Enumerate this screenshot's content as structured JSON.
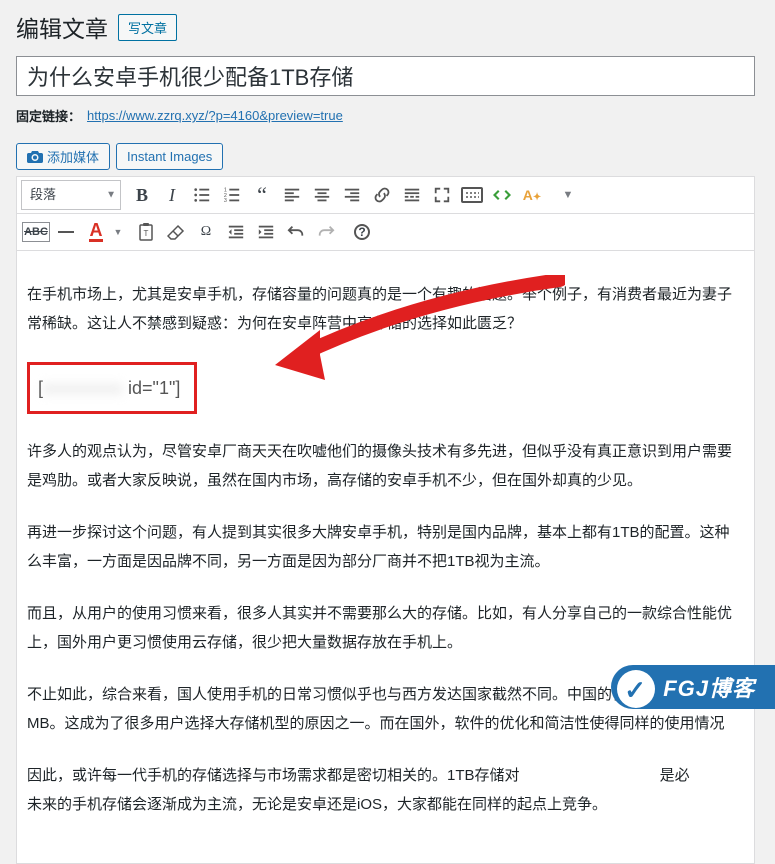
{
  "heading": {
    "title": "编辑文章",
    "new_post": "写文章"
  },
  "title_input": {
    "value": "为什么安卓手机很少配备1TB存储"
  },
  "permalink": {
    "label": "固定链接：",
    "url": "https://www.zzrq.xyz/?p=4160&preview=true"
  },
  "media": {
    "add_media": "添加媒体",
    "instant_images": "Instant Images"
  },
  "toolbar": {
    "format": "段落",
    "abc_strike": "ABC"
  },
  "shortcode": {
    "open": "[",
    "hidden": "xxxxxxxx",
    "suffix": "id=\"1\"]"
  },
  "content": {
    "p1": "在手机市场上，尤其是安卓手机，存储容量的问题真的是一个有趣的话题。举个例子，有消费者最近为妻子",
    "p2": "常稀缺。这让人不禁感到疑惑：为何在安卓阵营中高存储的选择如此匮乏？",
    "p3": "许多人的观点认为，尽管安卓厂商天天在吹嘘他们的摄像头技术有多先进，但似乎没有真正意识到用户需要",
    "p4": "是鸡肋。或者大家反映说，虽然在国内市场，高存储的安卓手机不少，但在国外却真的少见。",
    "p5": "再进一步探讨这个问题，有人提到其实很多大牌安卓手机，特别是国内品牌，基本上都有1TB的配置。这种",
    "p6": "么丰富，一方面是因品牌不同，另一方面是因为部分厂商并不把1TB视为主流。",
    "p7": "而且，从用户的使用习惯来看，很多人其实并不需要那么大的存储。比如，有人分享自己的一款综合性能优",
    "p8": "上，国外用户更习惯使用云存储，很少把大量数据存放在手机上。",
    "p9": "不止如此，综合来看，国人使用手机的日常习惯似乎也与西方发达国家截然不同。中国的很多APP普遍占用",
    "p10": "MB。这成为了很多用户选择大存储机型的原因之一。而在国外，软件的优化和简洁性使得同样的使用情况",
    "p11a": "因此，或许每一代手机的存储选择与市场需求都是密切相关的。1TB存储对",
    "p11b": "是必",
    "p12": "未来的手机存储会逐渐成为主流，无论是安卓还是iOS，大家都能在同样的起点上竞争。"
  },
  "badge": {
    "text": "FGJ博客"
  }
}
